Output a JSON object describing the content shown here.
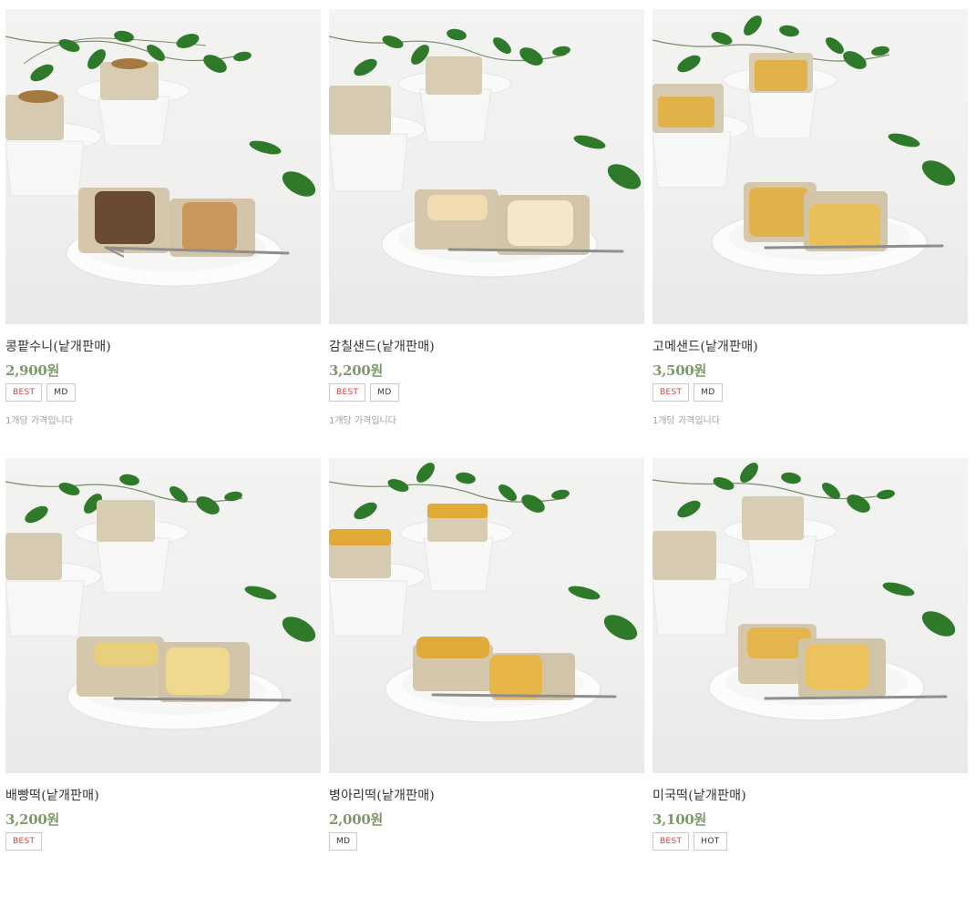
{
  "products": [
    {
      "name": "콩팥수니(낱개판매)",
      "price": "2,900원",
      "badges": [
        "BEST",
        "MD"
      ],
      "desc": "1개당 가격입니다",
      "filling_colors": [
        "#6b4a34",
        "#c9975a"
      ]
    },
    {
      "name": "감칠샌드(낱개판매)",
      "price": "3,200원",
      "badges": [
        "BEST",
        "MD"
      ],
      "desc": "1개당 가격입니다",
      "filling_colors": [
        "#f0dcb0",
        "#f5e7c9"
      ]
    },
    {
      "name": "고메샌드(낱개판매)",
      "price": "3,500원",
      "badges": [
        "BEST",
        "MD"
      ],
      "desc": "1개당 가격입니다",
      "filling_colors": [
        "#e2b24a",
        "#e8c05a"
      ]
    },
    {
      "name": "배빵떡(낱개판매)",
      "price": "3,200원",
      "badges": [
        "BEST"
      ],
      "desc": "",
      "filling_colors": [
        "#e8cf7a",
        "#efd98f"
      ]
    },
    {
      "name": "병아리떡(낱개판매)",
      "price": "2,000원",
      "badges": [
        "MD"
      ],
      "desc": "",
      "filling_colors": [
        "#e0a938",
        "#e7b548"
      ]
    },
    {
      "name": "미국떡(낱개판매)",
      "price": "3,100원",
      "badges": [
        "BEST",
        "HOT"
      ],
      "desc": "",
      "filling_colors": [
        "#e4b54c",
        "#ecc25c"
      ]
    }
  ],
  "colors": {
    "price": "#7e9a6c",
    "best_badge": "#e03a3a",
    "badge_border": "#c9c9c9",
    "desc": "#a0a0a0",
    "leaf": "#2f7a2a"
  },
  "icons": {
    "thumbnail": "product-photo"
  }
}
